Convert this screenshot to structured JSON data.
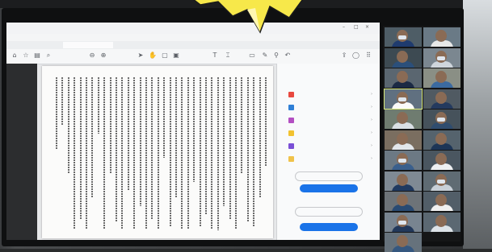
{
  "app": {
    "title_bar_text": "",
    "menu": [
      "",
      "",
      "",
      "",
      ""
    ],
    "tab_label": "",
    "toolbar_icons": [
      "home-icon",
      "bookmark-icon",
      "print-icon",
      "search-icon",
      "zoom-icon",
      "cursor-icon",
      "hand-icon",
      "select-icon",
      "comment-icon",
      "pen-icon",
      "undo-icon"
    ]
  },
  "document": {
    "page_header": "",
    "column_count": 36
  },
  "right_panel": {
    "tools": [
      {
        "label": "",
        "icon": "edit-pdf-icon",
        "color": "#e8483f"
      },
      {
        "label": "",
        "icon": "export-icon",
        "color": "#2f7fd6"
      },
      {
        "label": "",
        "icon": "organize-icon",
        "color": "#b34fc2"
      },
      {
        "label": "",
        "icon": "comment-icon",
        "color": "#f2c230"
      },
      {
        "label": "",
        "icon": "fill-sign-icon",
        "color": "#7a4fd6"
      },
      {
        "label": "",
        "icon": "more-tools-icon",
        "color": "#f0c24a"
      }
    ],
    "outline_button": "",
    "primary_button_1": "",
    "outline_button_2": "",
    "primary_button_2": ""
  },
  "video_call": {
    "participant_count": 21,
    "active_tile_index": 6
  },
  "colors": {
    "accent": "#1a73e8",
    "burst": "#f7e84a"
  }
}
